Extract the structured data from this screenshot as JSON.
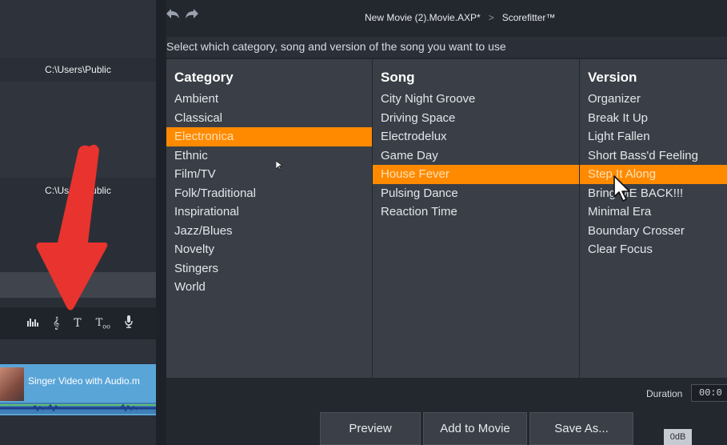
{
  "left_pane": {
    "path_1": "C:\\Users\\Public",
    "path_2": "C:\\Users\\Public",
    "toolbar_icons": [
      "equalizer-icon",
      "treble-clef-icon",
      "title-text-icon",
      "subtitle-text-icon",
      "microphone-icon"
    ],
    "track_title": "Singer Video with Audio.m"
  },
  "header": {
    "back_icon": "undo-arrow-icon",
    "forward_icon": "redo-arrow-icon",
    "project_name": "New Movie (2).Movie.AXP",
    "modified_mark": "*",
    "separator": ">",
    "current_page": "Scorefitter™"
  },
  "instruction": "Select which category, song and version of the song you want to use",
  "category": {
    "heading": "Category",
    "items": [
      "Ambient",
      "Classical",
      "Electronica",
      "Ethnic",
      "Film/TV",
      "Folk/Traditional",
      "Inspirational",
      "Jazz/Blues",
      "Novelty",
      "Stingers",
      "World"
    ],
    "selected": "Electronica"
  },
  "song": {
    "heading": "Song",
    "items": [
      "City Night Groove",
      "Driving Space",
      "Electrodelux",
      "Game Day",
      "House Fever",
      "Pulsing Dance",
      "Reaction Time"
    ],
    "selected": "House Fever"
  },
  "version": {
    "heading": "Version",
    "items": [
      "Organizer",
      "Break It Up",
      "Light Fallen",
      "Short Bass'd Feeling",
      "Step It Along",
      "Bring ME BACK!!!",
      "Minimal Era",
      "Boundary Crosser",
      "Clear Focus"
    ],
    "selected": "Step It Along"
  },
  "bottom": {
    "duration_label": "Duration",
    "duration_value": "00:0",
    "preview_label": "Preview",
    "add_label": "Add to Movie",
    "save_label": "Save As...",
    "db_badge": "0dB"
  },
  "colors": {
    "selection": "#ff8a00",
    "annotation_arrow": "#e8332e"
  }
}
